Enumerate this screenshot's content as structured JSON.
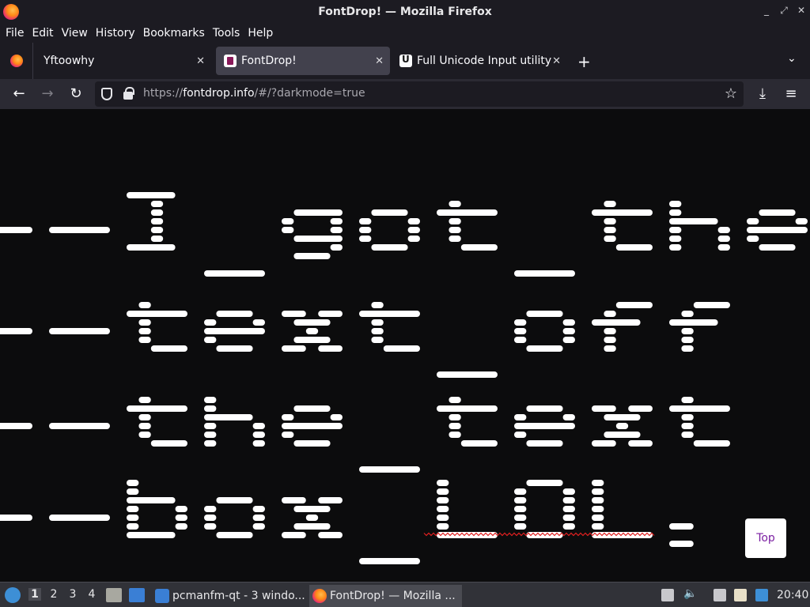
{
  "window": {
    "title": "FontDrop! — Mozilla Firefox",
    "controls": [
      "_",
      "⤢",
      "✕"
    ]
  },
  "menu": [
    "File",
    "Edit",
    "View",
    "History",
    "Bookmarks",
    "Tools",
    "Help"
  ],
  "tabs": [
    {
      "label": "Yftoowhy",
      "close": "✕"
    },
    {
      "label": "FontDrop!",
      "close": "✕"
    },
    {
      "label": "Full Unicode Input utility",
      "close": "✕"
    }
  ],
  "toolbar": {
    "new_tab": "+",
    "tab_list": "⌄",
    "back": "←",
    "forward": "→",
    "reload": "↻",
    "downloads": "⤓",
    "menu": "≡"
  },
  "url": {
    "prefix": "https://",
    "domain": "fontdrop.info",
    "path": "/#/?darkmode=true",
    "star": "☆"
  },
  "content": {
    "rendered_lines": [
      "--I_got_the",
      "--text_off",
      "--the_text",
      "--box_LOL."
    ],
    "top_button": "Top",
    "text_color": "#ffffff",
    "spellcheck_color": "#e02020"
  },
  "taskbar": {
    "desktops": [
      "1",
      "2",
      "3",
      "4"
    ],
    "tasks": [
      {
        "label": "pcmanfm-qt - 3 windo..."
      },
      {
        "label": "FontDrop! — Mozilla ..."
      }
    ],
    "clock": "20:40"
  }
}
